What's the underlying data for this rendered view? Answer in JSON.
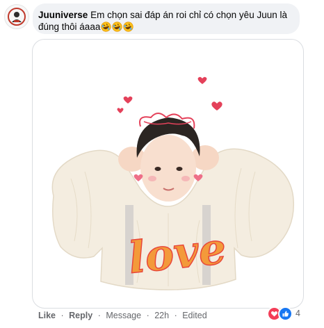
{
  "comment": {
    "author": "Juuniverse",
    "text": "Em chọn sai đáp án roi chỉ có chọn yêu Juun là đúng thôi áaaa",
    "emoji_icons": [
      "rolling-on-floor-laughing-emoji",
      "rolling-on-floor-laughing-emoji",
      "rolling-on-floor-laughing-emoji"
    ]
  },
  "sticker": {
    "caption": "love",
    "colors": {
      "caption_orange": "#f39a3a",
      "caption_red": "#e8473a",
      "hearts": "#e4415a"
    }
  },
  "actions": {
    "like_label": "Like",
    "reply_label": "Reply",
    "message_label": "Message",
    "time": "22h",
    "edited_label": "Edited",
    "separator": "·"
  },
  "reactions": {
    "icons": [
      "love-reaction-icon",
      "like-reaction-icon"
    ],
    "count": "4",
    "colors": {
      "love": "#f33e58",
      "like": "#1877f2"
    }
  }
}
